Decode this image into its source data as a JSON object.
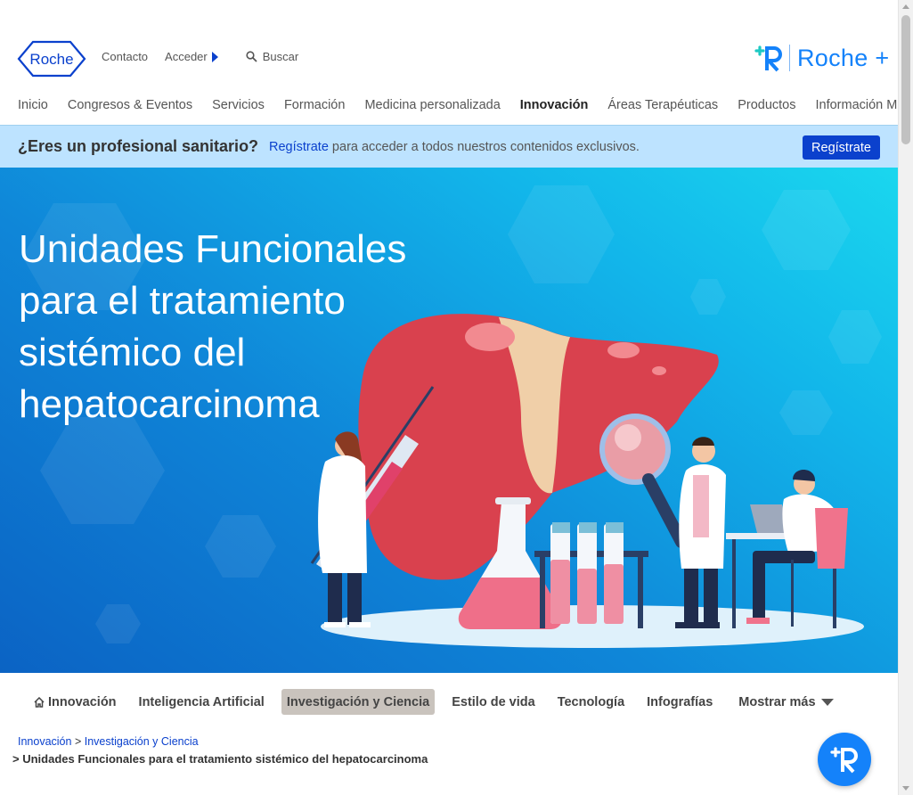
{
  "header": {
    "logo_text": "Roche",
    "top_links": {
      "contact": "Contacto",
      "login": "Acceder",
      "search": "Buscar"
    },
    "roche_plus_text": "Roche +"
  },
  "nav": {
    "items": [
      {
        "label": "Inicio",
        "active": false
      },
      {
        "label": "Congresos & Eventos",
        "active": false
      },
      {
        "label": "Servicios",
        "active": false
      },
      {
        "label": "Formación",
        "active": false
      },
      {
        "label": "Medicina personalizada",
        "active": false
      },
      {
        "label": "Innovación",
        "active": true
      },
      {
        "label": "Áreas Terapéuticas",
        "active": false
      },
      {
        "label": "Productos",
        "active": false
      },
      {
        "label": "Información Médica",
        "active": false
      }
    ]
  },
  "banner": {
    "question": "¿Eres un profesional sanitario?",
    "link": "Regístrate",
    "text": " para acceder a todos nuestros contenidos exclusivos.",
    "button": "Regístrate"
  },
  "hero": {
    "title": "Unidades Funcionales para el tratamiento sistémico del hepatocarcinoma"
  },
  "subnav": {
    "tabs": [
      {
        "label": "Innovación",
        "icon": "home-icon",
        "active": false
      },
      {
        "label": "Inteligencia Artificial",
        "active": false
      },
      {
        "label": "Investigación y Ciencia",
        "active": true
      },
      {
        "label": "Estilo de vida",
        "active": false
      },
      {
        "label": "Tecnología",
        "active": false
      },
      {
        "label": "Infografías",
        "active": false
      }
    ],
    "more": "Mostrar más"
  },
  "breadcrumb": {
    "items": [
      "Innovación",
      "Investigación y Ciencia"
    ],
    "separator": ">",
    "current": "> Unidades Funcionales para el tratamiento sistémico del hepatocarcinoma"
  },
  "colors": {
    "brand_blue": "#0b41cd",
    "roche_plus_blue": "#1482fa",
    "banner_bg": "#bde3ff",
    "active_tab_bg": "#c9c3bd"
  }
}
